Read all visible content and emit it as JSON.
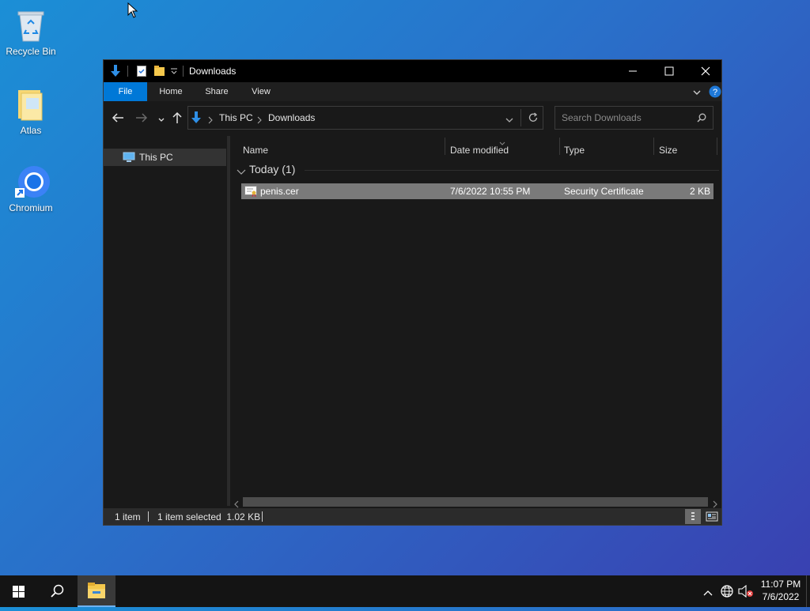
{
  "desktop": {
    "icons": [
      {
        "label": "Recycle Bin"
      },
      {
        "label": "Atlas"
      },
      {
        "label": "Chromium"
      }
    ]
  },
  "window": {
    "title": "Downloads",
    "ribbon_tabs": [
      "File",
      "Home",
      "Share",
      "View"
    ],
    "breadcrumb": [
      "This PC",
      "Downloads"
    ],
    "search_placeholder": "Search Downloads",
    "nav_items": [
      "This PC"
    ],
    "columns": [
      "Name",
      "Date modified",
      "Type",
      "Size"
    ],
    "group_label": "Today (1)",
    "files": [
      {
        "name": "penis.cer",
        "date": "7/6/2022 10:55 PM",
        "type": "Security Certificate",
        "size": "2 KB"
      }
    ],
    "status": {
      "count": "1 item",
      "selected": "1 item selected  1.02 KB"
    }
  },
  "taskbar": {
    "time": "11:07 PM",
    "date": "7/6/2022"
  },
  "colors": {
    "accent": "#0078d7",
    "selected_row": "#7a7a7a"
  }
}
